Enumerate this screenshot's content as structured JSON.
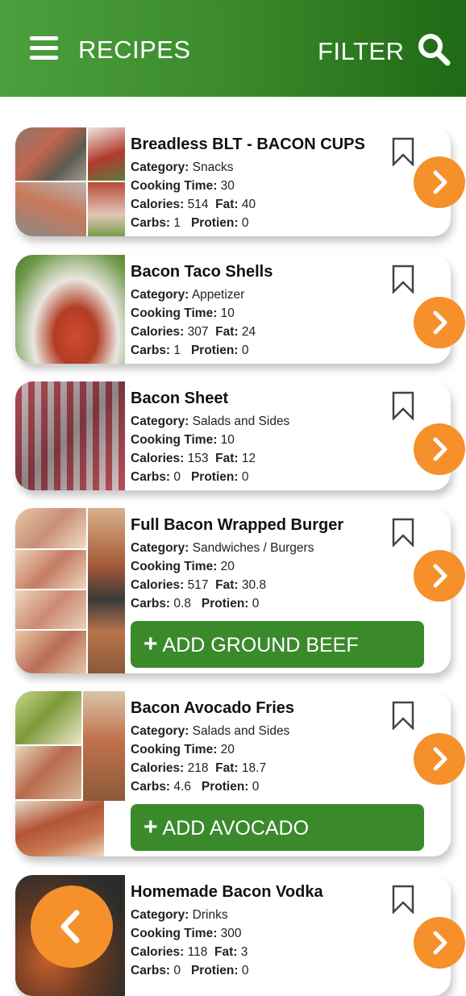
{
  "header": {
    "title": "RECIPES",
    "filter_label": "FILTER"
  },
  "labels": {
    "category": "Category:",
    "cooking_time": "Cooking Time:",
    "calories": "Calories:",
    "fat": "Fat:",
    "carbs": "Carbs:",
    "protien": "Protien:"
  },
  "recipes": [
    {
      "title": "Breadless BLT - BACON CUPS",
      "category": "Snacks",
      "cooking_time": "30",
      "calories": "514",
      "fat": "40",
      "carbs": "1",
      "protien": "0"
    },
    {
      "title": "Bacon Taco Shells",
      "category": "Appetizer",
      "cooking_time": "10",
      "calories": "307",
      "fat": "24",
      "carbs": "1",
      "protien": "0"
    },
    {
      "title": "Bacon Sheet",
      "category": "Salads and Sides",
      "cooking_time": "10",
      "calories": "153",
      "fat": "12",
      "carbs": "0",
      "protien": "0"
    },
    {
      "title": "Full Bacon Wrapped Burger",
      "category": "Sandwiches / Burgers",
      "cooking_time": "20",
      "calories": "517",
      "fat": "30.8",
      "carbs": "0.8",
      "protien": "0",
      "add_label": "ADD GROUND BEEF"
    },
    {
      "title": "Bacon Avocado Fries",
      "category": "Salads and Sides",
      "cooking_time": "20",
      "calories": "218",
      "fat": "18.7",
      "carbs": "4.6",
      "protien": "0",
      "add_label": "ADD AVOCADO"
    },
    {
      "title": "Homemade Bacon Vodka",
      "category": "Drinks",
      "cooking_time": "300",
      "calories": "118",
      "fat": "3",
      "carbs": "0",
      "protien": "0"
    }
  ],
  "icons": {
    "menu": "hamburger-menu-icon",
    "search": "search-icon",
    "bookmark": "bookmark-icon",
    "next": "chevron-right-icon",
    "back": "chevron-left-icon"
  },
  "colors": {
    "header_green": "#3a8a2b",
    "accent_orange": "#f5902a",
    "button_green": "#3a8a2b"
  }
}
